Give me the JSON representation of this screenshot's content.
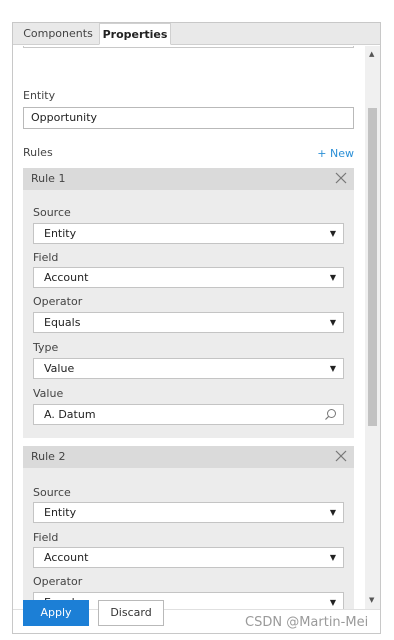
{
  "tabs": {
    "components": "Components",
    "properties": "Properties"
  },
  "entity": {
    "label": "Entity",
    "value": "Opportunity"
  },
  "rules": {
    "label": "Rules",
    "new_link": "+ New",
    "items": [
      {
        "title": "Rule 1",
        "source_label": "Source",
        "source_value": "Entity",
        "field_label": "Field",
        "field_value": "Account",
        "operator_label": "Operator",
        "operator_value": "Equals",
        "type_label": "Type",
        "type_value": "Value",
        "value_label": "Value",
        "value_value": "A. Datum"
      },
      {
        "title": "Rule 2",
        "source_label": "Source",
        "source_value": "Entity",
        "field_label": "Field",
        "field_value": "Account",
        "operator_label": "Operator",
        "operator_value": "Equals"
      }
    ]
  },
  "footer": {
    "apply_label": "Apply",
    "discard_label": "Discard"
  },
  "icons": {
    "dropdown": "triangle-down-icon",
    "close": "close-icon",
    "search": "search-icon"
  },
  "colors": {
    "accent": "#1c7fd6",
    "link": "#2b8fd6",
    "rule_header": "#dadada",
    "rule_body": "#ececec"
  },
  "watermark": "CSDN @Martin-Mei"
}
